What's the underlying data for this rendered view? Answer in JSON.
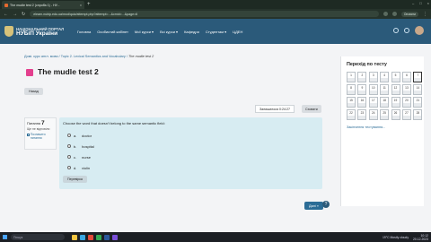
{
  "browser": {
    "tab_title": "The mudle test 2 (спроба 1) - НУ...",
    "url": "elearn.nubip.edu.ua/mod/quiz/attempt.php?attempt=...&cmid=...&page=6",
    "update_label": "Оновити"
  },
  "header": {
    "logo_line1": "НАЦІОНАЛЬНИЙ ПОРТАЛ",
    "logo_line2": "НУБіП України",
    "menu": [
      "Головна",
      "Особистий кабінет",
      "Мої курси ▾",
      "Всі курси ▾",
      "Кафедри",
      "Студентам ▾",
      "ЦДЕН"
    ]
  },
  "breadcrumb": {
    "items": [
      "Домі. курс англ. мови",
      "/",
      "Topic 2. Lexical Semantics and Vocabulary",
      "/"
    ],
    "current": "The mudle test 2"
  },
  "page": {
    "title": "The mudle test 2",
    "back_label": "Назад",
    "timer_label": "Залишилося 0:24:27",
    "hide_label": "Сховати"
  },
  "question_info": {
    "label": "Питання",
    "number": "7",
    "status": "Ще не відповіли",
    "flag_label": "Позначити питання"
  },
  "question": {
    "text": "Choose the word that doesn't belong to the same semantic field:",
    "options": [
      {
        "letter": "a.",
        "text": "doctor"
      },
      {
        "letter": "b.",
        "text": "hospital"
      },
      {
        "letter": "c.",
        "text": "nurse"
      },
      {
        "letter": "d.",
        "text": "violin"
      }
    ],
    "clear_label": "Перевірка"
  },
  "next_label": "Далі »",
  "help_label": "?",
  "quiz_nav": {
    "title": "Перехід по тесту",
    "cells": [
      "1",
      "2",
      "3",
      "4",
      "5",
      "6",
      "7",
      "8",
      "9",
      "10",
      "11",
      "12",
      "13",
      "14",
      "15",
      "16",
      "17",
      "18",
      "19",
      "20",
      "21",
      "22",
      "23",
      "24",
      "25",
      "26",
      "27",
      "28"
    ],
    "current": "7",
    "finish_label": "Закінчення тестування..."
  },
  "taskbar": {
    "search_label": "Пошук",
    "weather": "19°C  Mostly cloudy",
    "time": "10:12",
    "date": "20.12.2023"
  }
}
